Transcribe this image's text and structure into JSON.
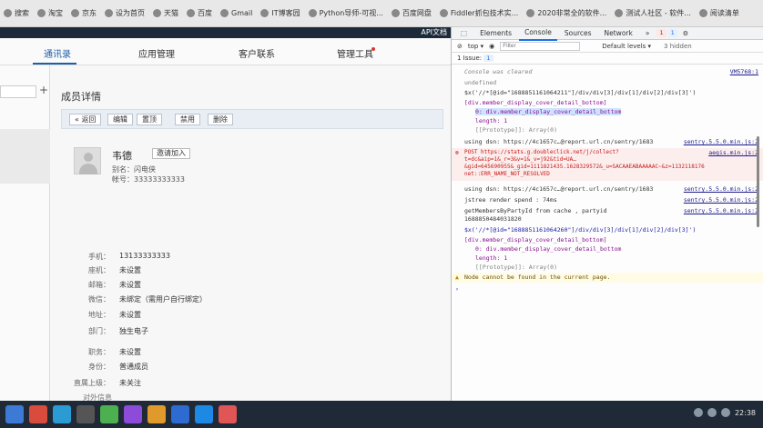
{
  "bookmarks": [
    {
      "label": "搜索",
      "icon": "search-icon"
    },
    {
      "label": "淘宝",
      "icon": "taobao-icon"
    },
    {
      "label": "京东",
      "icon": "jd-icon"
    },
    {
      "label": "设为首页",
      "icon": "home-icon"
    },
    {
      "label": "天猫",
      "icon": "tmall-icon"
    },
    {
      "label": "百度",
      "icon": "baidu-icon"
    },
    {
      "label": "Gmail",
      "icon": "gmail-icon"
    },
    {
      "label": "IT博客园",
      "icon": "blog-icon"
    },
    {
      "label": "Python导师-可视...",
      "icon": "python-icon"
    },
    {
      "label": "百度网盘",
      "icon": "pan-icon"
    },
    {
      "label": "Fiddler抓包技术实...",
      "icon": "fiddler-icon"
    },
    {
      "label": "2020非常全的软件...",
      "icon": "software-icon"
    },
    {
      "label": "测试人社区 - 软件...",
      "icon": "community-icon"
    },
    {
      "label": "阅读清单",
      "icon": "reading-list-icon"
    }
  ],
  "app": {
    "api_link": "API文档",
    "nav": [
      {
        "label": "通讯录",
        "active": true
      },
      {
        "label": "应用管理",
        "active": false
      },
      {
        "label": "客户联系",
        "active": false
      },
      {
        "label": "管理工具",
        "active": false
      }
    ],
    "add_symbol": "+",
    "detail_title": "成员详情",
    "toolbar": {
      "back": "« 返回",
      "edit": "编辑",
      "pin": "置顶",
      "disable": "禁用",
      "delete": "删除"
    },
    "member": {
      "name": "韦德",
      "invite": "邀请加入",
      "alias_label": "别名：",
      "alias_value": "闪电侠",
      "account_label": "帐号：",
      "account_value": "33333333333"
    },
    "fields": [
      {
        "label": "手机：",
        "value": "13133333333"
      },
      {
        "label": "座机：",
        "value": "未设置"
      },
      {
        "label": "邮箱：",
        "value": "未设置"
      },
      {
        "label": "微信：",
        "value": "未绑定（需用户自行绑定）"
      },
      {
        "label": "地址：",
        "value": "未设置"
      },
      {
        "label": "部门：",
        "value": "独生电子"
      },
      {
        "label": "职务：",
        "value": "未设置"
      },
      {
        "label": "身份：",
        "value": "普通成员"
      },
      {
        "label": "直属上级：",
        "value": "未关注"
      }
    ],
    "footer_label": "对外信息"
  },
  "devtools": {
    "tabs": [
      "Elements",
      "Console",
      "Sources",
      "Network"
    ],
    "more": "»",
    "error_badge": "1",
    "info_badge": "1",
    "top_context": "top ▾",
    "filter_placeholder": "Filter",
    "levels": "Default levels ▾",
    "hidden": "3 hidden",
    "issues": "1 Issue:",
    "issues_count": "1",
    "lines": {
      "cleared": "Console was cleared",
      "cleared_src": "VM5768:1",
      "undef": "undefined",
      "cmd1": "$x('//*[@id=\"1688851161064211\"]/div/div[3]/div[1]/div[2]/div[3]')",
      "arr1": "[div.member_display_cover_detail_bottom]",
      "item0": "0: div.member_display_cover_detail_bottom",
      "len1": "length: 1",
      "proto1": "[[Prototype]]: Array(0)",
      "dsn1": "using dsn: https://4c1657c…@report.url.cn/sentry/1683",
      "dsn1_src": "sentry.5.5.0.min.js:2",
      "post": "POST https://stats.g.doubleclick.net/j/collect?t=dc&aip=1&_r=3&v=1&_v=j92&tid=UA…&gid=645690955&_gid=1111821435.1628329572&_u=SACAAEABAAAAAC~&z=1132118176 net::ERR_NAME_NOT_RESOLVED",
      "post_src": "aegis.min.js:2",
      "dsn2": "using dsn: https://4c1657c…@report.url.cn/sentry/1683",
      "dsn2_src": "sentry.5.5.0.min.js:2",
      "jstree": "jstree render spend : 74ms",
      "jstree_src": "sentry.5.5.0.min.js:2",
      "members": "getMembersByPartyId from cache , partyid 1688850484031820",
      "members_src": "sentry.5.5.0.min.js:2",
      "cmd2": "$x('//*[@id=\"1688851161064260\"]/div/div[3]/div[1]/div[2]/div[3]')",
      "arr2": "[div.member_display_cover_detail_bottom]",
      "item0b": "0: div.member_display_cover_detail_bottom",
      "len2": "length: 1",
      "proto2": "[[Prototype]]: Array(0)",
      "warn": "Node cannot be found in the current page."
    }
  },
  "taskbar": {
    "clock": "22:38"
  },
  "colors": {
    "accent": "#1f5fa8",
    "error_bg": "#fdeeee",
    "warn_bg": "#fffbe5",
    "taskbar": "#1f2a36"
  }
}
